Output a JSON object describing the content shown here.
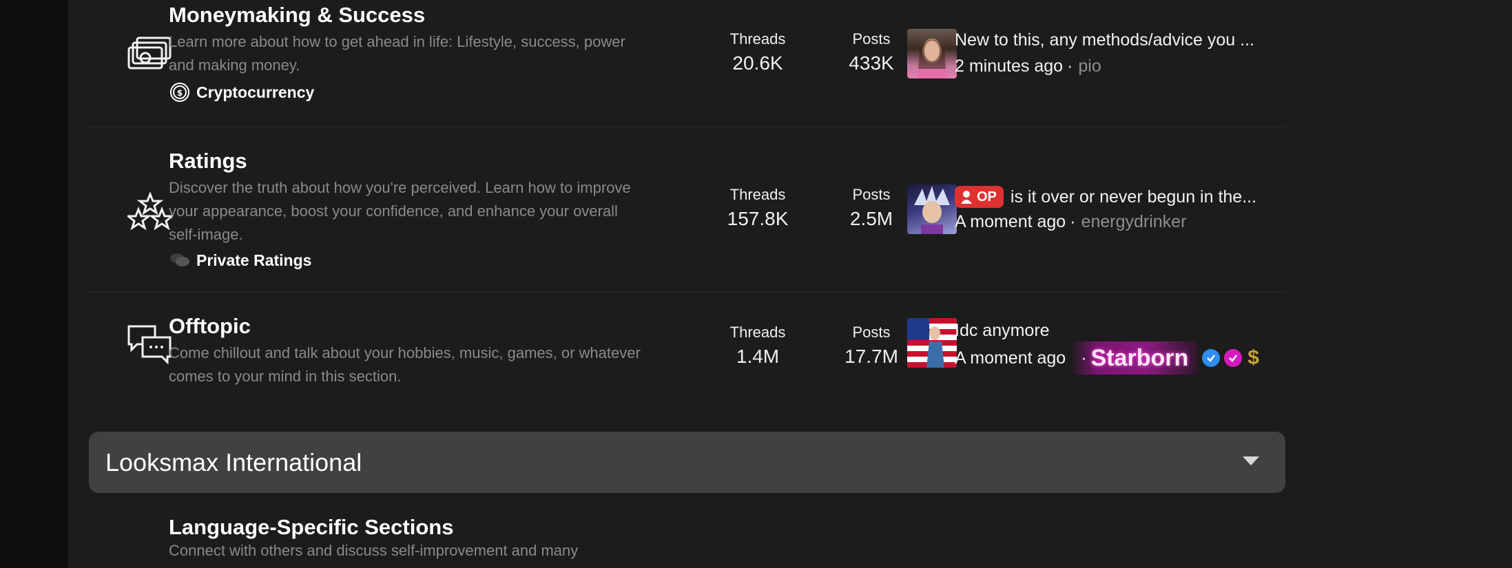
{
  "forums": [
    {
      "title": "Moneymaking & Success",
      "description": "Learn more about how to get ahead in life: Lifestyle, success, power and making money.",
      "subforum": "Cryptocurrency",
      "icon": "money-icon",
      "sub_icon": "coin-icon",
      "threads_label": "Threads",
      "threads": "20.6K",
      "posts_label": "Posts",
      "posts": "433K",
      "last_post": {
        "title": "New to this, any methods/advice you ...",
        "time": "2 minutes ago",
        "user": "pio"
      }
    },
    {
      "title": "Ratings",
      "description": "Discover the truth about how you're perceived. Learn how to improve your appearance, boost your confidence, and enhance your overall self-image.",
      "subforum": "Private Ratings",
      "icon": "stars-icon",
      "sub_icon": "chat-bubbles-icon",
      "threads_label": "Threads",
      "threads": "157.8K",
      "posts_label": "Posts",
      "posts": "2.5M",
      "last_post": {
        "badge": "OP",
        "title": "is it over or never begun in the...",
        "time": "A moment ago",
        "user": "energydrinker"
      }
    },
    {
      "title": "Offtopic",
      "description": "Come chillout and talk about your hobbies, music, games, or whatever comes to your mind in this section.",
      "icon": "chat-icon",
      "threads_label": "Threads",
      "threads": "1.4M",
      "posts_label": "Posts",
      "posts": "17.7M",
      "last_post": {
        "title": "Idc anymore",
        "time": "A moment ago",
        "user": "Starborn"
      }
    }
  ],
  "category": {
    "title": "Looksmax International"
  },
  "next_forum": {
    "title": "Language-Specific Sections",
    "description": "Connect with others and discuss self-improvement and many"
  },
  "colors": {
    "background": "#1c1c1c",
    "op_badge": "#e03131",
    "category_bar": "#414141"
  }
}
